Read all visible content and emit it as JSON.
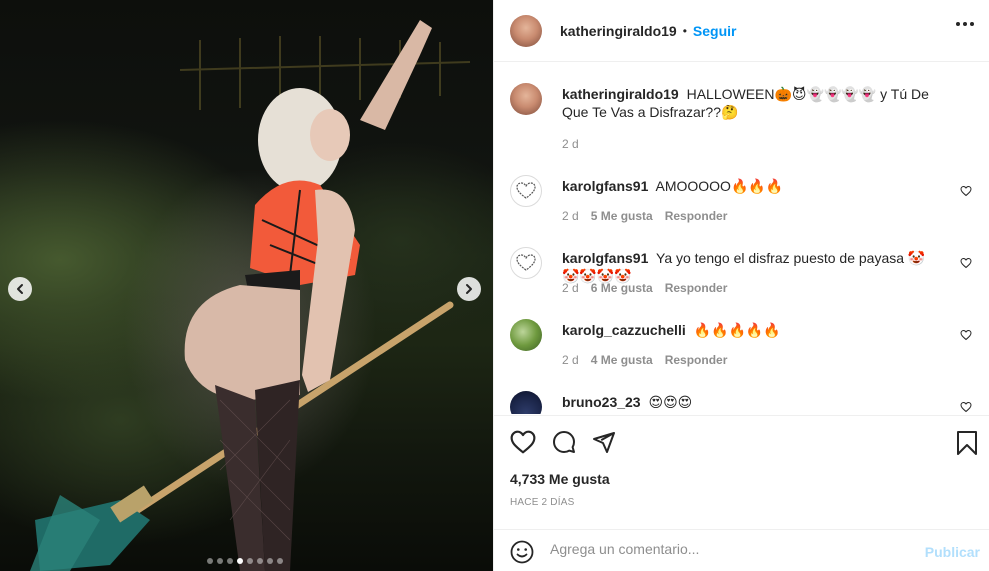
{
  "post": {
    "author": "katheringiraldo19",
    "follow_label": "Seguir",
    "separator": "•",
    "caption_user": "katheringiraldo19",
    "caption_text": "HALLOWEEN🎃😈👻👻👻👻 y Tú De Que Te Vas a Disfrazar??🤔",
    "caption_time": "2 d",
    "likes_label": "4,733 Me gusta",
    "time_ago": "HACE 2 DÍAS"
  },
  "comments": [
    {
      "user": "karolgfans91",
      "text": "AMOOOOO🔥🔥🔥",
      "time": "2 d",
      "likes": "5 Me gusta",
      "reply": "Responder"
    },
    {
      "user": "karolgfans91",
      "text": "Ya yo tengo el disfraz puesto de payasa 🤡🤡🤡🤡🤡",
      "time": "2 d",
      "likes": "6 Me gusta",
      "reply": "Responder"
    },
    {
      "user": "karolg_cazzuchelli",
      "text": "🔥🔥🔥🔥🔥",
      "time": "2 d",
      "likes": "4 Me gusta",
      "reply": "Responder"
    },
    {
      "user": "bruno23_23",
      "text": "😍😍😍"
    }
  ],
  "composer": {
    "placeholder": "Agrega un comentario...",
    "publish_label": "Publicar"
  },
  "carousel": {
    "total_slides": 8,
    "active_index": 3
  },
  "colors": {
    "link": "#0095f6",
    "publish_disabled": "#b2dffc",
    "meta": "#8e8e8e",
    "text": "#262626"
  }
}
